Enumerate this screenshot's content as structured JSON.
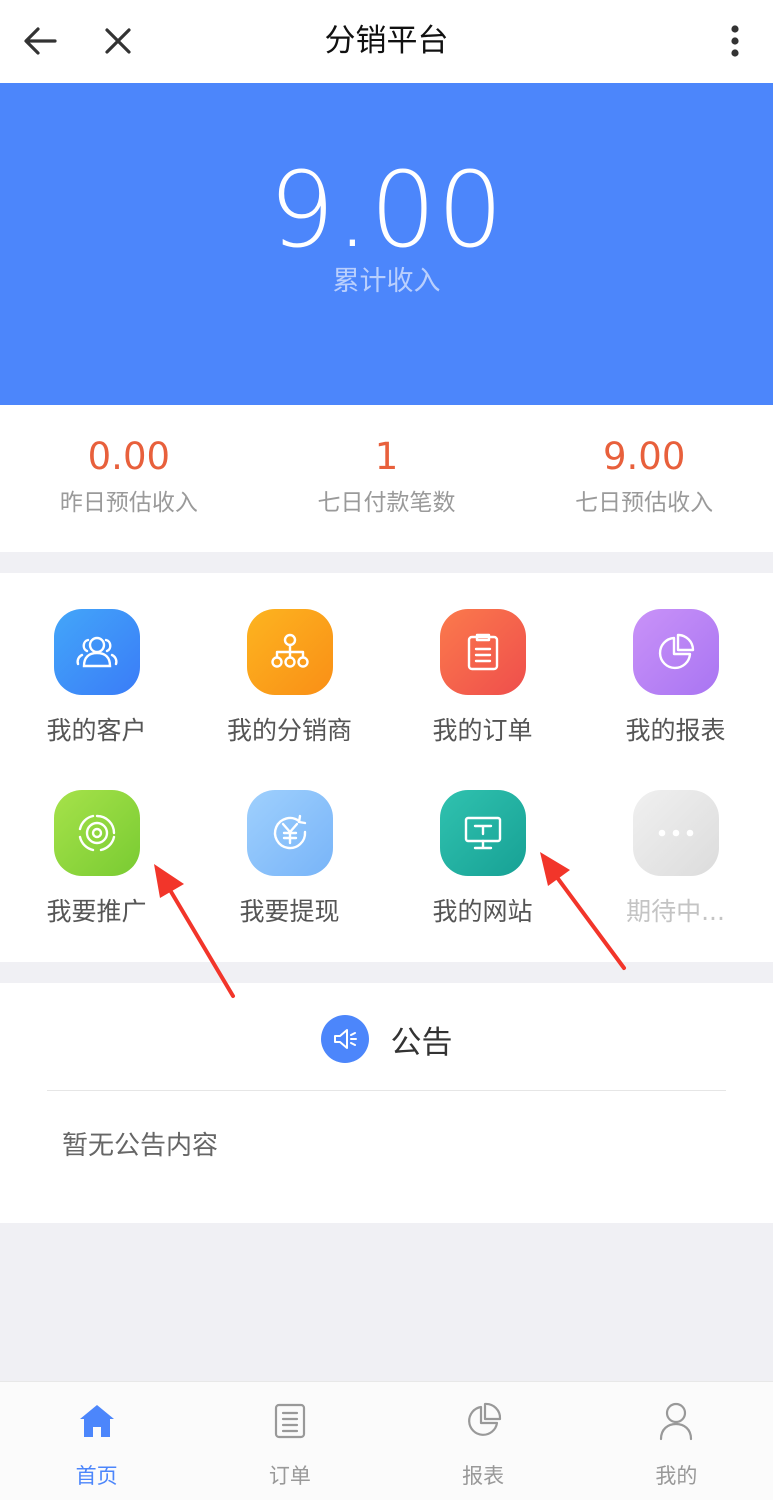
{
  "header": {
    "title": "分销平台",
    "back_icon": "arrow-left-icon",
    "close_icon": "close-icon",
    "more_icon": "more-vertical-icon"
  },
  "hero": {
    "amount": "9.00",
    "label": "累计收入",
    "background": "#4c86fb"
  },
  "stats": [
    {
      "value": "0.00",
      "label": "昨日预估收入"
    },
    {
      "value": "1",
      "label": "七日付款笔数"
    },
    {
      "value": "9.00",
      "label": "七日预估收入"
    }
  ],
  "grid": [
    {
      "label": "我的客户",
      "icon": "users-icon",
      "color": "#3f8ef9"
    },
    {
      "label": "我的分销商",
      "icon": "org-tree-icon",
      "color": "#fba11c"
    },
    {
      "label": "我的订单",
      "icon": "document-list-icon",
      "color": "#f2654b"
    },
    {
      "label": "我的报表",
      "icon": "pie-chart-icon",
      "color": "#bf86f5"
    },
    {
      "label": "我要推广",
      "icon": "target-icon",
      "color": "#8fd83d"
    },
    {
      "label": "我要提现",
      "icon": "yen-refresh-icon",
      "color": "#8dc3fb"
    },
    {
      "label": "我的网站",
      "icon": "monitor-icon",
      "color": "#22b0a2"
    },
    {
      "label": "期待中...",
      "icon": "more-dots-icon",
      "color": "#e4e4e4"
    }
  ],
  "notice": {
    "title": "公告",
    "icon": "speaker-icon",
    "empty_text": "暂无公告内容"
  },
  "tabs": [
    {
      "label": "首页",
      "icon": "home-icon",
      "active": true
    },
    {
      "label": "订单",
      "icon": "order-list-icon",
      "active": false
    },
    {
      "label": "报表",
      "icon": "pie-chart-outline-icon",
      "active": false
    },
    {
      "label": "我的",
      "icon": "user-icon",
      "active": false
    }
  ],
  "colors": {
    "accent": "#4c86fb",
    "stat_value": "#e8603c",
    "annotation_arrow": "#f2352a"
  }
}
